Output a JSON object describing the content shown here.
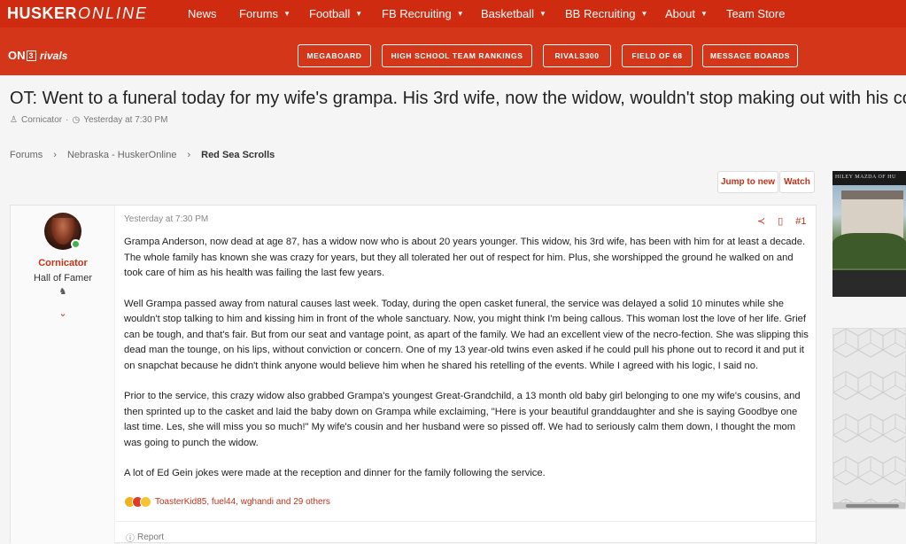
{
  "site": {
    "logo_bold": "HUSKER",
    "logo_italic": "ONLINE"
  },
  "nav": [
    {
      "label": "News",
      "caret": false
    },
    {
      "label": "Forums",
      "caret": true
    },
    {
      "label": "Football",
      "caret": true
    },
    {
      "label": "FB Recruiting",
      "caret": true
    },
    {
      "label": "Basketball",
      "caret": true
    },
    {
      "label": "BB Recruiting",
      "caret": true
    },
    {
      "label": "About",
      "caret": true
    },
    {
      "label": "Team Store",
      "caret": false
    }
  ],
  "brand": {
    "on3": "ON",
    "on3_box": "3",
    "rivals": "rivals"
  },
  "subnav_buttons": [
    "MEGABOARD",
    "HIGH SCHOOL TEAM RANKINGS",
    "RIVALS300",
    "FIELD OF 68",
    "MESSAGE BOARDS"
  ],
  "thread": {
    "title": "OT: Went to a funeral today for my wife's grampa. His 3rd wife, now the widow, wouldn't stop making out with his corpse..",
    "author": "Cornicator",
    "date": "Yesterday at 7:30 PM"
  },
  "breadcrumb": [
    "Forums",
    "Nebraska - HuskerOnline",
    "Red Sea Scrolls"
  ],
  "actions": {
    "jump": "Jump to new",
    "watch": "Watch"
  },
  "post": {
    "username": "Cornicator",
    "user_title": "Hall of Famer",
    "date": "Yesterday at 7:30 PM",
    "number": "#1",
    "paragraphs": [
      "Grampa Anderson, now dead at age 87, has a widow now who is about 20 years younger. This widow, his 3rd wife, has been with him for at least a decade. The whole family has known she was crazy for years, but they all tolerated her out of respect for him. Plus, she worshipped the ground he walked on and took care of him as his health was failing the last few years.",
      "Well Grampa passed away from natural causes last week. Today, during the open casket funeral, the service was delayed a solid 10 minutes while she wouldn't stop talking to him and kissing him in front of the whole sanctuary. Now, you might think I'm being callous. This woman lost the love of her life. Grief can be tough, and that's fair. But from our seat and vantage point, as apart of the family. We had an excellent view of the necro-fection. She was slipping this dead man the tounge, on his lips, without conviction or concern. One of my 13 year-old twins even asked if he could pull his phone out to record it and put it on snapchat because he didn't think anyone would believe him when he shared his retelling of the events. While I agreed with his logic, I said no.",
      "Prior to the service, this crazy widow also grabbed Grampa's youngest Great-Grandchild, a 13 month old baby girl belonging to one my wife's cousins, and then sprinted up to the casket and laid the baby down on Grampa while exclaiming, \"Here is your beautiful granddaughter and she is saying Goodbye one last time. Les, she will miss you so much!\" My wife's cousin and her husband were so pissed off. We had to seriously calm them down, I thought the mom was going to punch the widow.",
      "A lot of Ed Gein jokes were made at the reception and dinner for the family following the service."
    ],
    "reactions": "ToasterKid85, fuel44, wghandi and 29 others",
    "report": "Report"
  },
  "ad": {
    "header": "HILEY MAZDA OF HU"
  },
  "colors": {
    "brand_red": "#cf2b10",
    "link_red": "#c0321a"
  }
}
